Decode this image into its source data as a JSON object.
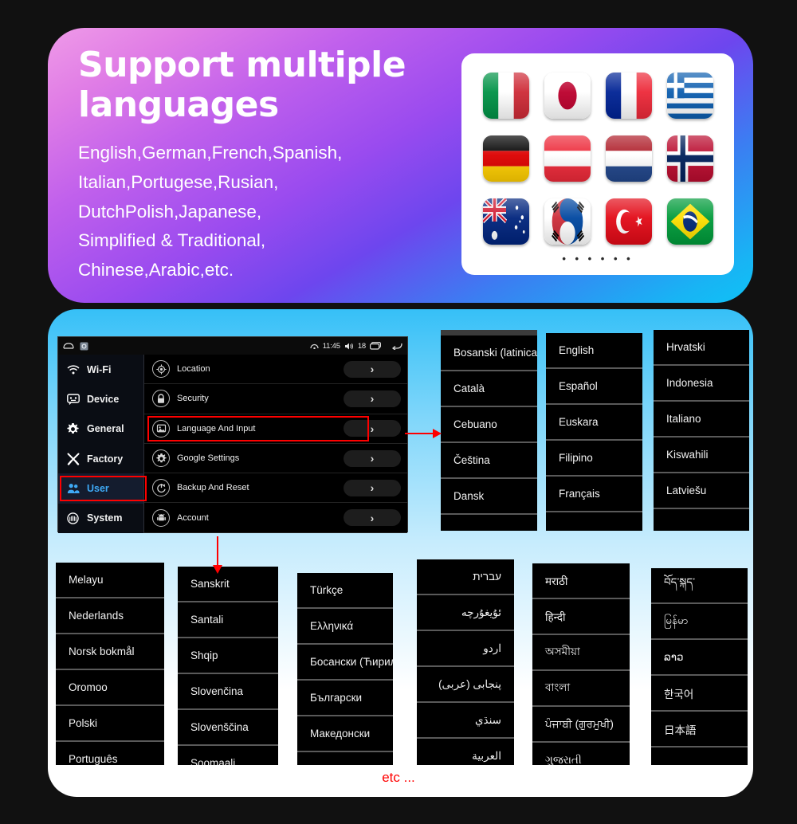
{
  "banner": {
    "title": "Support multiple languages",
    "subtitle_lines": [
      "English,German,French,Spanish,",
      "Italian,Portugese,Rusian,",
      "DutchPolish,Japanese,",
      "Simplified & Traditional,",
      "Chinese,Arabic,etc."
    ],
    "dots": "• • • • • •",
    "flags": [
      {
        "name": "flag-italy",
        "label": "Italy"
      },
      {
        "name": "flag-japan",
        "label": "Japan"
      },
      {
        "name": "flag-france",
        "label": "France"
      },
      {
        "name": "flag-greece",
        "label": "Greece"
      },
      {
        "name": "flag-germany",
        "label": "Germany"
      },
      {
        "name": "flag-austria",
        "label": "Austria"
      },
      {
        "name": "flag-netherlands",
        "label": "Netherlands"
      },
      {
        "name": "flag-norway",
        "label": "Norway"
      },
      {
        "name": "flag-australia",
        "label": "Australia"
      },
      {
        "name": "flag-south-korea",
        "label": "South Korea"
      },
      {
        "name": "flag-turkey",
        "label": "Turkey"
      },
      {
        "name": "flag-brazil",
        "label": "Brazil"
      }
    ]
  },
  "device": {
    "statusbar": {
      "time": "11:45",
      "volume": "18",
      "icons": [
        "home-icon",
        "settings-icon",
        "radio-icon",
        "speaker-icon",
        "recents-icon",
        "back-icon"
      ]
    },
    "nav": [
      {
        "label": "Wi-Fi",
        "icon": "wifi-icon",
        "active": false
      },
      {
        "label": "Device",
        "icon": "device-icon",
        "active": false
      },
      {
        "label": "General",
        "icon": "gear-icon",
        "active": false
      },
      {
        "label": "Factory",
        "icon": "tools-icon",
        "active": false
      },
      {
        "label": "User",
        "icon": "user-icon",
        "active": true
      },
      {
        "label": "System",
        "icon": "system-icon",
        "active": false
      }
    ],
    "rows": [
      {
        "label": "Location",
        "icon": "location-icon",
        "chevron": "›",
        "highlighted": false
      },
      {
        "label": "Security",
        "icon": "lock-icon",
        "chevron": "›",
        "highlighted": false
      },
      {
        "label": "Language And Input",
        "icon": "language-icon",
        "chevron": "›",
        "highlighted": true
      },
      {
        "label": "Google Settings",
        "icon": "gear-icon",
        "chevron": "›",
        "highlighted": false
      },
      {
        "label": "Backup And Reset",
        "icon": "backup-icon",
        "chevron": "›",
        "highlighted": false
      },
      {
        "label": "Account",
        "icon": "android-icon",
        "chevron": "›",
        "highlighted": false
      }
    ]
  },
  "language_columns": [
    {
      "name": "lang-column-1",
      "has_cap": true,
      "items": [
        "Bosanski (latinica)",
        "Català",
        "Cebuano",
        "Čeština",
        "Dansk",
        ""
      ]
    },
    {
      "name": "lang-column-2",
      "has_cap": false,
      "items": [
        "English",
        "Español",
        "Euskara",
        "Filipino",
        "Français",
        ""
      ]
    },
    {
      "name": "lang-column-3",
      "has_cap": false,
      "items": [
        "Hrvatski",
        "Indonesia",
        "Italiano",
        "Kiswahili",
        "Latviešu",
        ""
      ]
    },
    {
      "name": "lang-column-4",
      "has_cap": false,
      "items": [
        "Melayu",
        "Nederlands",
        "Norsk bokmål",
        "Oromoo",
        "Polski",
        "Português"
      ]
    },
    {
      "name": "lang-column-5",
      "has_cap": false,
      "items": [
        "Sanskrit",
        "Santali",
        "Shqip",
        "Slovenčina",
        "Slovenščina",
        "Soomaali"
      ]
    },
    {
      "name": "lang-column-6",
      "has_cap": false,
      "items": [
        "Türkçe",
        "Ελληνικά",
        "Босански (Ћирилица)",
        "Български",
        "Македонски",
        ""
      ]
    },
    {
      "name": "lang-column-7",
      "rtl": true,
      "has_cap": false,
      "items": [
        "עברית",
        "ئۇيغۇرچە",
        "اردو",
        "پنجابی (عربی)",
        "سنڌي",
        "العربية"
      ]
    },
    {
      "name": "lang-column-8",
      "has_cap": false,
      "items": [
        "मराठी",
        "हिन्दी",
        "অসমীয়া",
        "বাংলা",
        "ਪੰਜਾਬੀ (ਗੁਰਮੁਖੀ)",
        "ગુજરાતી"
      ]
    },
    {
      "name": "lang-column-9",
      "has_cap": false,
      "items": [
        "བོད་སྐད་",
        "မြန်မာ",
        "ລາວ",
        "한국어",
        "日本語",
        ""
      ]
    }
  ],
  "annotations": {
    "etc": "etc ...",
    "highlight_color": "#ff0000",
    "accent_color": "#3ea9f5"
  }
}
